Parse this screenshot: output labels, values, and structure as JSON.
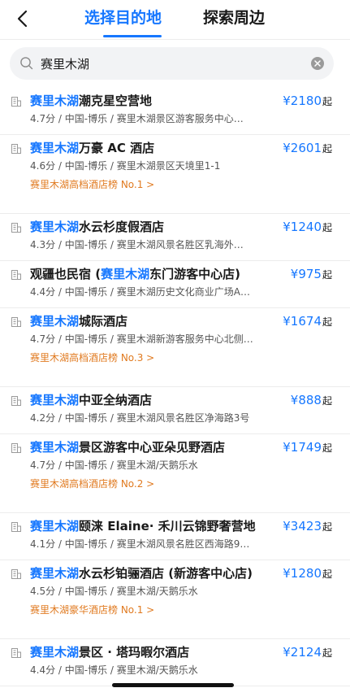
{
  "header": {
    "tabs": [
      {
        "label": "选择目的地",
        "active": true
      },
      {
        "label": "探索周边",
        "active": false
      }
    ]
  },
  "search": {
    "value": "赛里木湖"
  },
  "colors": {
    "accent": "#1677ff",
    "rank": "#e07a20"
  },
  "results": [
    {
      "highlight": "赛里木湖",
      "name_rest": "潮克星空营地",
      "name_pre": "",
      "name_post": "",
      "price": "¥2180",
      "price_suffix": "起",
      "meta": "4.7分 / 中国-博乐 / 赛里木湖景区游客服务中心…",
      "rank": ""
    },
    {
      "highlight": "赛里木湖",
      "name_rest": "万豪 AC 酒店",
      "name_pre": "",
      "name_post": "",
      "price": "¥2601",
      "price_suffix": "起",
      "meta": "4.6分 / 中国-博乐 / 赛里木湖景区天境里1-1",
      "rank": "赛里木湖高档酒店榜 No.1 >"
    },
    {
      "highlight": "赛里木湖",
      "name_rest": "水云杉度假酒店",
      "name_pre": "",
      "name_post": "",
      "price": "¥1240",
      "price_suffix": "起",
      "meta": "4.3分 / 中国-博乐 / 赛里木湖风景名胜区乳海外…",
      "rank": ""
    },
    {
      "highlight": "赛里木湖",
      "name_rest": "东门游客中心店)",
      "name_pre": "观疆也民宿 (",
      "name_post": "",
      "price": "¥975",
      "price_suffix": "起",
      "meta": "4.4分 / 中国-博乐 / 赛里木湖历史文化商业广场A…",
      "rank": ""
    },
    {
      "highlight": "赛里木湖",
      "name_rest": "城际酒店",
      "name_pre": "",
      "name_post": "",
      "price": "¥1674",
      "price_suffix": "起",
      "meta": "4.7分 / 中国-博乐 / 赛里木湖新游客服务中心北侧…",
      "rank": "赛里木湖高档酒店榜 No.3 >"
    },
    {
      "highlight": "赛里木湖",
      "name_rest": "中亚全纳酒店",
      "name_pre": "",
      "name_post": "",
      "price": "¥888",
      "price_suffix": "起",
      "meta": "4.2分 / 中国-博乐 / 赛里木湖风景名胜区净海路3号",
      "rank": ""
    },
    {
      "highlight": "赛里木湖",
      "name_rest": "景区游客中心亚朵见野酒店",
      "name_pre": "",
      "name_post": "",
      "price": "¥1749",
      "price_suffix": "起",
      "meta": "4.7分 / 中国-博乐 / 赛里木湖/天鹅乐水",
      "rank": "赛里木湖高档酒店榜 No.2 >"
    },
    {
      "highlight": "赛里木湖",
      "name_rest": "颐涞 Elaine· 禾川云锦野奢营地",
      "name_pre": "",
      "name_post": "",
      "price": "¥3423",
      "price_suffix": "起",
      "meta": "4.1分 / 中国-博乐 / 赛里木湖风景名胜区西海路9…",
      "rank": ""
    },
    {
      "highlight": "赛里木湖",
      "name_rest": "水云杉铂骊酒店 (新游客中心店)",
      "name_pre": "",
      "name_post": "",
      "price": "¥1280",
      "price_suffix": "起",
      "meta": "4.5分 / 中国-博乐 / 赛里木湖/天鹅乐水",
      "rank": "赛里木湖豪华酒店榜 No.1 >"
    },
    {
      "highlight": "赛里木湖",
      "name_rest": "景区 · 塔玛暇尔酒店",
      "name_pre": "",
      "name_post": "",
      "price": "¥2124",
      "price_suffix": "起",
      "meta": "4.4分 / 中国-博乐 / 赛里木湖/天鹅乐水",
      "rank": ""
    }
  ]
}
